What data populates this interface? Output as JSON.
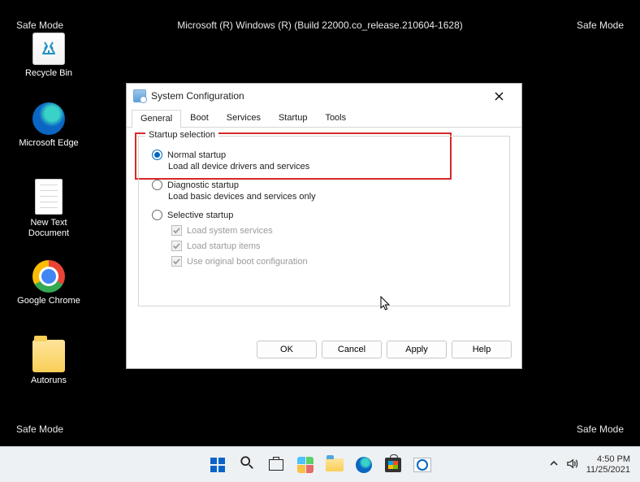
{
  "safemode_label": "Safe Mode",
  "header_text": "Microsoft (R) Windows (R) (Build 22000.co_release.210604-1628)",
  "desktop_icons": {
    "recycle": "Recycle Bin",
    "edge": "Microsoft Edge",
    "newtext": "New Text Document",
    "chrome": "Google Chrome",
    "autoruns": "Autoruns"
  },
  "dialog": {
    "title": "System Configuration",
    "tabs": [
      "General",
      "Boot",
      "Services",
      "Startup",
      "Tools"
    ],
    "group_label": "Startup selection",
    "options": {
      "normal": {
        "label": "Normal startup",
        "desc": "Load all device drivers and services"
      },
      "diagnostic": {
        "label": "Diagnostic startup",
        "desc": "Load basic devices and services only"
      },
      "selective": {
        "label": "Selective startup"
      }
    },
    "subs": {
      "sys": "Load system services",
      "startup": "Load startup items",
      "origboot": "Use original boot configuration"
    },
    "buttons": {
      "ok": "OK",
      "cancel": "Cancel",
      "apply": "Apply",
      "help": "Help"
    }
  },
  "systray": {
    "time": "4:50 PM",
    "date": "11/25/2021"
  }
}
